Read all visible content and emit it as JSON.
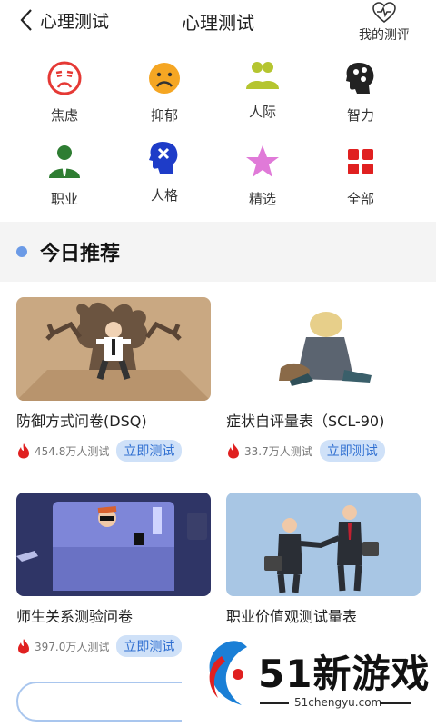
{
  "header": {
    "back_label": "心理测试",
    "title": "心理测试",
    "my_test_label": "我的测评"
  },
  "categories": [
    {
      "label": "焦虑",
      "icon": "anxious-face-icon",
      "color": "#e53935"
    },
    {
      "label": "抑郁",
      "icon": "sad-face-icon",
      "color": "#f5a623"
    },
    {
      "label": "人际",
      "icon": "people-icon",
      "color": "#b5c530"
    },
    {
      "label": "智力",
      "icon": "brain-head-icon",
      "color": "#222222"
    },
    {
      "label": "职业",
      "icon": "businessman-icon",
      "color": "#2e7d32"
    },
    {
      "label": "人格",
      "icon": "head-x-icon",
      "color": "#1e3cc8"
    },
    {
      "label": "精选",
      "icon": "star-icon",
      "color": "#e07ad8"
    },
    {
      "label": "全部",
      "icon": "grid-icon",
      "color": "#e02020"
    }
  ],
  "section": {
    "title": "今日推荐",
    "accent": "#6b9ae6"
  },
  "cards": [
    {
      "title": "防御方式问卷(DSQ)",
      "count": "454.8万人测试",
      "button": "立即测试",
      "image": "defense-illustration"
    },
    {
      "title": "症状自评量表（SCL-90)",
      "count": "33.7万人测试",
      "button": "立即测试",
      "image": "sitting-person-illustration"
    },
    {
      "title": "师生关系测验问卷",
      "count": "397.0万人测试",
      "button": "立即测试",
      "image": "bed-illustration"
    },
    {
      "title": "职业价值观测试量表",
      "count": "",
      "button": "",
      "image": "handshake-illustration"
    }
  ],
  "watermark": {
    "brand_num": "51",
    "brand_text": "新游戏",
    "url": "51chengyu.com"
  },
  "colors": {
    "button_bg": "#cfe1f8",
    "button_text": "#2f6fd1",
    "fire": "#e02020"
  }
}
